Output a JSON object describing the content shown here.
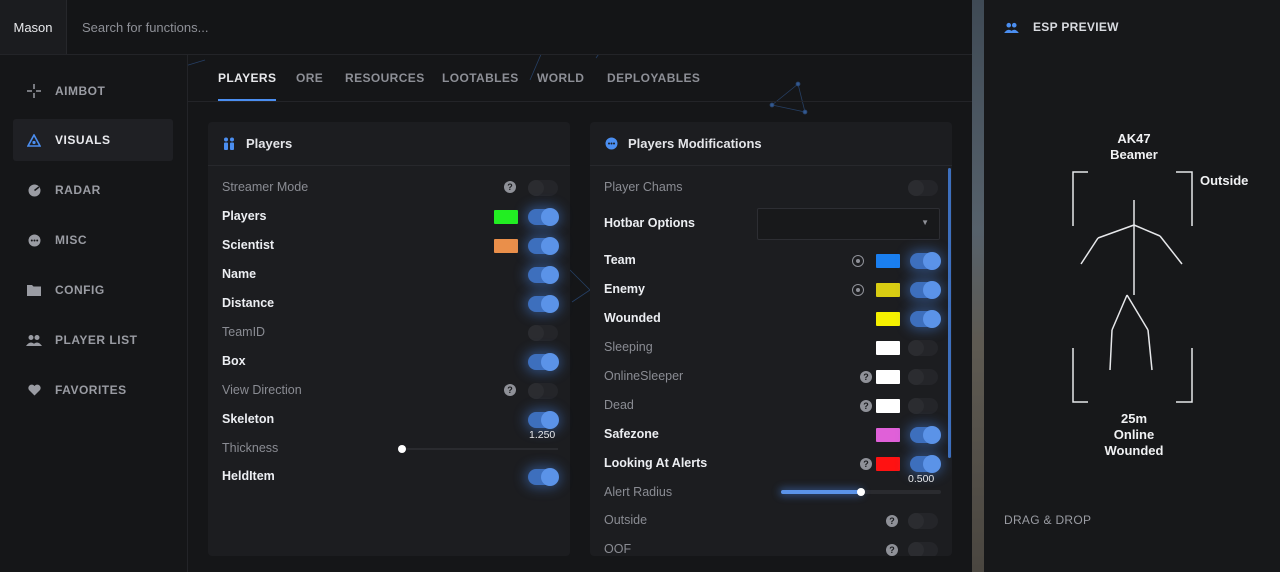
{
  "topbar": {
    "user": "Mason",
    "search_placeholder": "Search for functions..."
  },
  "sidebar": {
    "items": [
      {
        "label": "AIMBOT",
        "icon": "crosshair-icon"
      },
      {
        "label": "VISUALS",
        "icon": "triangle-eye-icon"
      },
      {
        "label": "RADAR",
        "icon": "radar-icon"
      },
      {
        "label": "MISC",
        "icon": "dots-icon"
      },
      {
        "label": "CONFIG",
        "icon": "folder-icon"
      },
      {
        "label": "PLAYER LIST",
        "icon": "users-icon"
      },
      {
        "label": "FAVORITES",
        "icon": "heart-icon"
      }
    ],
    "active": "VISUALS"
  },
  "tabs": [
    "PLAYERS",
    "ORE",
    "RESOURCES",
    "LOOTABLES",
    "WORLD",
    "DEPLOYABLES"
  ],
  "players_panel": {
    "title": "Players",
    "rows": [
      {
        "label": "Streamer Mode",
        "state": false,
        "help": true
      },
      {
        "label": "Players",
        "state": true,
        "color": "#22ee22"
      },
      {
        "label": "Scientist",
        "state": true,
        "color": "#ea8f4a"
      },
      {
        "label": "Name",
        "state": true
      },
      {
        "label": "Distance",
        "state": true
      },
      {
        "label": "TeamID",
        "state": false
      },
      {
        "label": "Box",
        "state": true
      },
      {
        "label": "View Direction",
        "state": false,
        "help": true
      },
      {
        "label": "Skeleton",
        "state": true,
        "value": "1.250"
      },
      {
        "label": "Thickness",
        "slider": 0.0
      },
      {
        "label": "HeldItem",
        "state": true
      }
    ]
  },
  "mods_panel": {
    "title": "Players Modifications",
    "player_chams": {
      "label": "Player Chams",
      "state": false
    },
    "hotbar": {
      "label": "Hotbar Options",
      "value": ""
    },
    "rows": [
      {
        "label": "Team",
        "state": true,
        "color": "#1a7ff0",
        "gear": true
      },
      {
        "label": "Enemy",
        "state": true,
        "color": "#d8cc12",
        "gear": true
      },
      {
        "label": "Wounded",
        "state": true,
        "color": "#f5f000"
      },
      {
        "label": "Sleeping",
        "state": false,
        "color": "#ffffff"
      },
      {
        "label": "OnlineSleeper",
        "state": false,
        "color": "#ffffff",
        "help": true
      },
      {
        "label": "Dead",
        "state": false,
        "color": "#ffffff",
        "help": true
      },
      {
        "label": "Safezone",
        "state": true,
        "color": "#e060d8"
      },
      {
        "label": "Looking At Alerts",
        "state": true,
        "color": "#ff1212",
        "help": true,
        "value": "0.500"
      },
      {
        "label": "Alert Radius",
        "slider": 0.5
      },
      {
        "label": "Outside",
        "state": false,
        "help": true
      },
      {
        "label": "OOF",
        "state": false,
        "help": true
      }
    ]
  },
  "esp_preview": {
    "title": "ESP PREVIEW",
    "weapon": "AK47",
    "name": "Beamer",
    "side_label": "Outside",
    "distance": "25m",
    "status1": "Online",
    "status2": "Wounded",
    "footer": "DRAG & DROP"
  }
}
